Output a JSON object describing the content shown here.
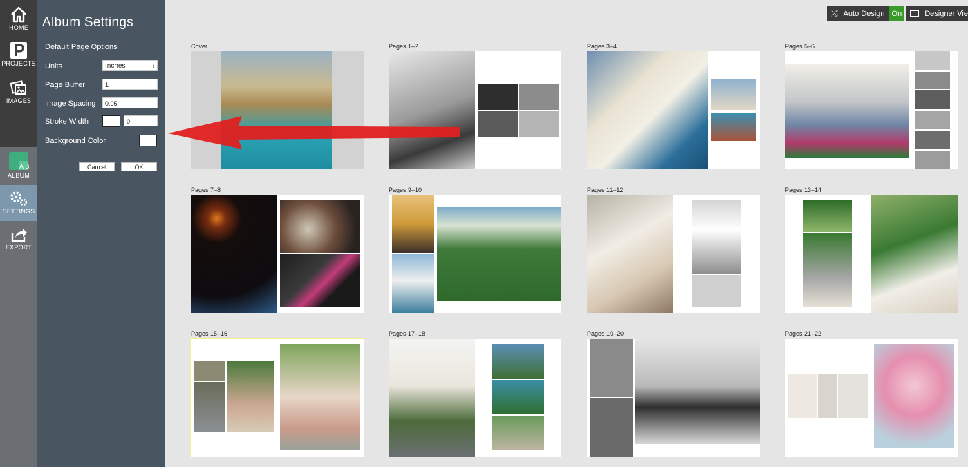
{
  "rail": {
    "items": [
      {
        "label": "HOME"
      },
      {
        "label": "PROJECTS"
      },
      {
        "label": "IMAGES"
      },
      {
        "label": "ALBUM"
      },
      {
        "label": "SETTINGS"
      },
      {
        "label": "EXPORT"
      }
    ],
    "album_icon_text": "A B"
  },
  "panel": {
    "title": "Album Settings",
    "subtitle": "Default Page Options",
    "units_label": "Units",
    "units_value": "Inches",
    "page_buffer_label": "Page Buffer",
    "page_buffer_value": "1",
    "image_spacing_label": "Image Spacing",
    "image_spacing_value": "0.05",
    "stroke_width_label": "Stroke Width",
    "stroke_width_value": "0",
    "background_color_label": "Background Color",
    "cancel_label": "Cancel",
    "ok_label": "OK"
  },
  "toolbar": {
    "auto_design_label": "Auto Design",
    "auto_design_state": "On",
    "designer_view_label": "Designer Vie"
  },
  "spreads": [
    {
      "label": "Cover"
    },
    {
      "label": "Pages 1–2"
    },
    {
      "label": "Pages 3–4"
    },
    {
      "label": "Pages 5–6"
    },
    {
      "label": "Pages 7–8"
    },
    {
      "label": "Pages 9–10"
    },
    {
      "label": "Pages 11–12"
    },
    {
      "label": "Pages 13–14"
    },
    {
      "label": "Pages 15–16"
    },
    {
      "label": "Pages 17–18"
    },
    {
      "label": "Pages 19–20"
    },
    {
      "label": "Pages 21–22"
    }
  ],
  "colors": {
    "rail": "#3d3d3d",
    "panel": "#4a5562",
    "active": "#7d98ad",
    "on_green": "#3a9a2a",
    "arrow": "#e02020",
    "selected_outline": "#f2f090"
  }
}
